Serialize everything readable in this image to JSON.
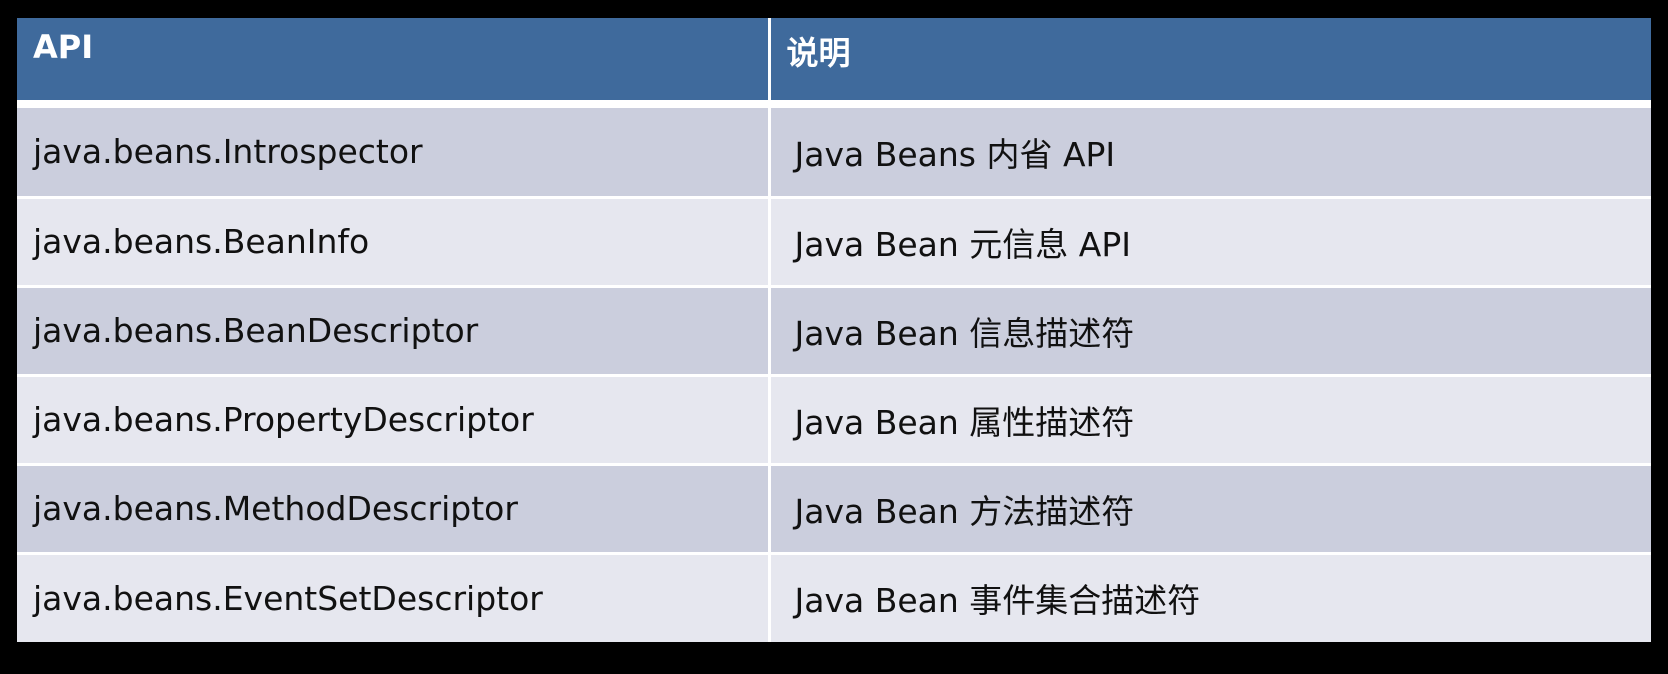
{
  "table": {
    "headers": [
      "API",
      "说明"
    ],
    "rows": [
      [
        "java.beans.Introspector",
        "Java Beans 内省 API"
      ],
      [
        "java.beans.BeanInfo",
        "Java Bean 元信息 API"
      ],
      [
        "java.beans.BeanDescriptor",
        "Java Bean 信息描述符"
      ],
      [
        "java.beans.PropertyDescriptor",
        "Java Bean 属性描述符"
      ],
      [
        "java.beans.MethodDescriptor",
        "Java Bean 方法描述符"
      ],
      [
        "java.beans.EventSetDescriptor",
        "Java Bean 事件集合描述符"
      ]
    ]
  },
  "colors": {
    "header_bg": "#3f6a9c",
    "row_odd_bg": "#cbcedd",
    "row_even_bg": "#e6e7ef",
    "background": "#000000"
  }
}
